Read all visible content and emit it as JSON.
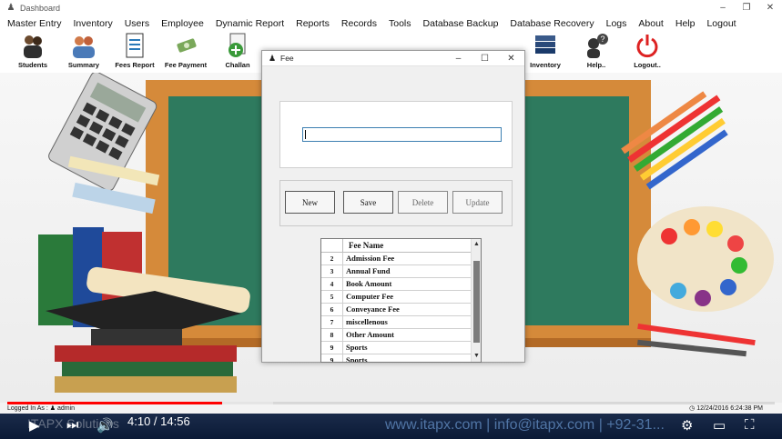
{
  "window": {
    "title": "Dashboard",
    "icon": "user-icon",
    "controls": [
      "–",
      "❐",
      "✕"
    ]
  },
  "menu": [
    "Master Entry",
    "Inventory",
    "Users",
    "Employee",
    "Dynamic Report",
    "Reports",
    "Records",
    "Tools",
    "Database Backup",
    "Database Recovery",
    "Logs",
    "About",
    "Help",
    "Logout"
  ],
  "toolbar": [
    {
      "label": "Students",
      "icon": "students-icon"
    },
    {
      "label": "Summary",
      "icon": "summary-icon"
    },
    {
      "label": "Fees Report",
      "icon": "fees-report-icon"
    },
    {
      "label": "Fee Payment",
      "icon": "fee-payment-icon"
    },
    {
      "label": "Challan",
      "icon": "challan-icon"
    },
    {
      "label": "Inventory",
      "icon": "inventory-books-icon"
    },
    {
      "label": "Help..",
      "icon": "help-icon"
    },
    {
      "label": "Logout..",
      "icon": "power-icon"
    }
  ],
  "dialog": {
    "title": "Fee",
    "input_value": "",
    "buttons": {
      "new": "New",
      "save": "Save",
      "delete": "Delete",
      "update": "Update"
    },
    "grid": {
      "column": "Fee Name",
      "rows": [
        {
          "num": "2",
          "name": "Admission Fee"
        },
        {
          "num": "3",
          "name": "Annual Fund"
        },
        {
          "num": "4",
          "name": "Book Amount"
        },
        {
          "num": "5",
          "name": "Computer Fee"
        },
        {
          "num": "6",
          "name": "Conveyance Fee"
        },
        {
          "num": "7",
          "name": "miscellenous"
        },
        {
          "num": "8",
          "name": "Other Amount"
        },
        {
          "num": "9",
          "name": "Sports"
        },
        {
          "num": "9",
          "name": "Sports"
        }
      ]
    }
  },
  "status": {
    "logged_in_label": "Logged In As :",
    "user": "admin",
    "datetime": "12/24/2016 6:24:38 PM"
  },
  "player": {
    "time": "4:10 / 14:56",
    "progress_played": 0.28,
    "brand": "ITAPX Solutions",
    "contact": "www.itapx.com | info@itapx.com | +92-31..."
  }
}
